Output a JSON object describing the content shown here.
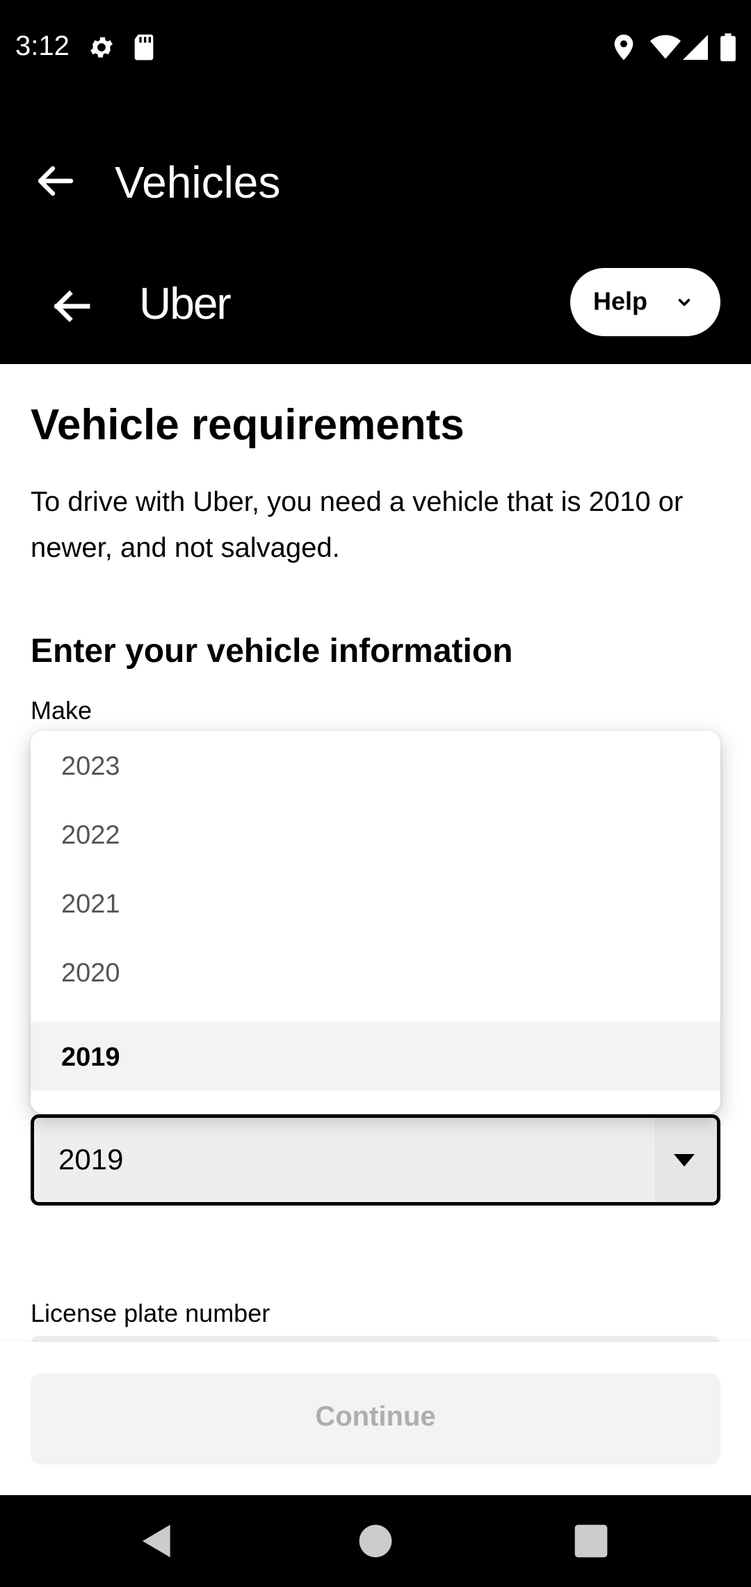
{
  "status_bar": {
    "time": "3:12",
    "icons": [
      "settings-icon",
      "sd-card-icon",
      "location-icon",
      "wifi-icon",
      "signal-icon",
      "battery-icon"
    ]
  },
  "app_bar": {
    "title": "Vehicles",
    "back_icon": "arrow-left-icon"
  },
  "uber_header": {
    "logo_text": "Uber",
    "back_icon": "arrow-left-icon",
    "help_label": "Help",
    "help_icon": "chevron-down-icon"
  },
  "main": {
    "title": "Vehicle requirements",
    "description": "To drive with Uber, you need a vehicle that is 2010 or newer, and not salvaged.",
    "section_title": "Enter your vehicle information",
    "make_label": "Make",
    "year_select": {
      "value": "2019",
      "icon": "caret-down-icon"
    },
    "plate_label": "License plate number"
  },
  "dropdown": {
    "options": [
      {
        "label": "2023",
        "selected": false
      },
      {
        "label": "2022",
        "selected": false
      },
      {
        "label": "2021",
        "selected": false
      },
      {
        "label": "2020",
        "selected": false
      },
      {
        "label": "2019",
        "selected": true
      }
    ]
  },
  "footer": {
    "continue_label": "Continue"
  },
  "nav_bar": {
    "icons": [
      "nav-back-icon",
      "nav-home-icon",
      "nav-recents-icon"
    ]
  },
  "colors": {
    "header_bg": "#000000",
    "page_bg": "#ffffff",
    "field_bg": "#eeeeee",
    "selected_option_bg": "#f3f3f3",
    "disabled_text": "#aeaeae"
  }
}
